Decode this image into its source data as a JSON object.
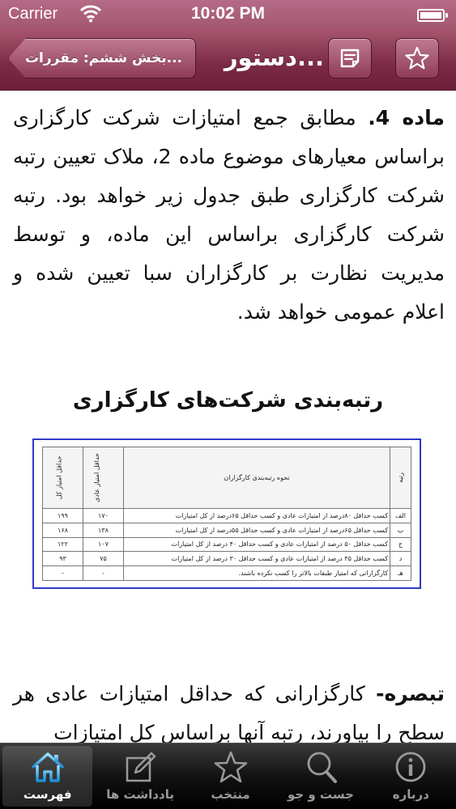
{
  "status_bar": {
    "carrier": "Carrier",
    "time": "10:02 PM"
  },
  "nav": {
    "back_label": "بخش ششم: مقررات...",
    "title": "دستور...",
    "notes_icon": "note-icon",
    "star_icon": "star-icon"
  },
  "content": {
    "para1_bold": "ماده 4.",
    "para1_text": " مطابق جمع امتیازات شرکت کارگزاری براساس معیارهای موضوع ماده 2، ملاک تعیین رتبه شرکت کارگزاری طبق جدول زیر خواهد بود. رتبه شرکت کارگزاری براساس این ماده، و توسط مدیریت نظارت بر کارگزاران سبا تعیین شده و اعلام عمومی خواهد شد.",
    "table_title": "رتبه‌بندی شرکت‌های کارگزاری",
    "table": {
      "headers": [
        "رتبه",
        "نحوه رتبه‌بندی کارگزاران",
        "حداقل امتیاز عادی",
        "حداقل امتیاز کل"
      ],
      "rows": [
        [
          "الف",
          "کسب حداقل ۸۰درصد از امتیازات عادی   و کسب حداقل ۶۵درصد از کل امتیازات",
          "۱۷۰",
          "۱۹۹"
        ],
        [
          "ب",
          "کسب حداقل ۶۵درصد از امتیازات عادی   و کسب حداقل ۵۵درصد از کل امتیازات",
          "۱۳۸",
          "۱۶۸"
        ],
        [
          "ج",
          "کسب حداقل ۵۰ درصد از امتیازات عادی   و کسب حداقل ۴۰ درصد از کل امتیازات",
          "۱۰۷",
          "۱۲۲"
        ],
        [
          "د",
          "کسب حداقل ۳۵ درصد از امتیازات عادی   و کسب حداقل ۳۰ درصد از کل امتیازات",
          "۷۵",
          "۹۳"
        ],
        [
          "هـ",
          "کارگزارانی که امتیاز طبقات بالاتر را کسب نکرده باشند.",
          "-",
          "-"
        ]
      ]
    },
    "para2_bold": "تبصره-",
    "para2_text": " کارگزارانی که حداقل امتیازات عادی هر سطح را بیاورند، رتبه آنها براساس کل امتیازات"
  },
  "tabs": [
    {
      "label": "فهرست",
      "icon": "home-icon",
      "active": true
    },
    {
      "label": "یادداشت ها",
      "icon": "compose-icon",
      "active": false
    },
    {
      "label": "منتخب",
      "icon": "star-icon",
      "active": false
    },
    {
      "label": "جست و جو",
      "icon": "search-icon",
      "active": false
    },
    {
      "label": "درباره",
      "icon": "info-icon",
      "active": false
    }
  ]
}
